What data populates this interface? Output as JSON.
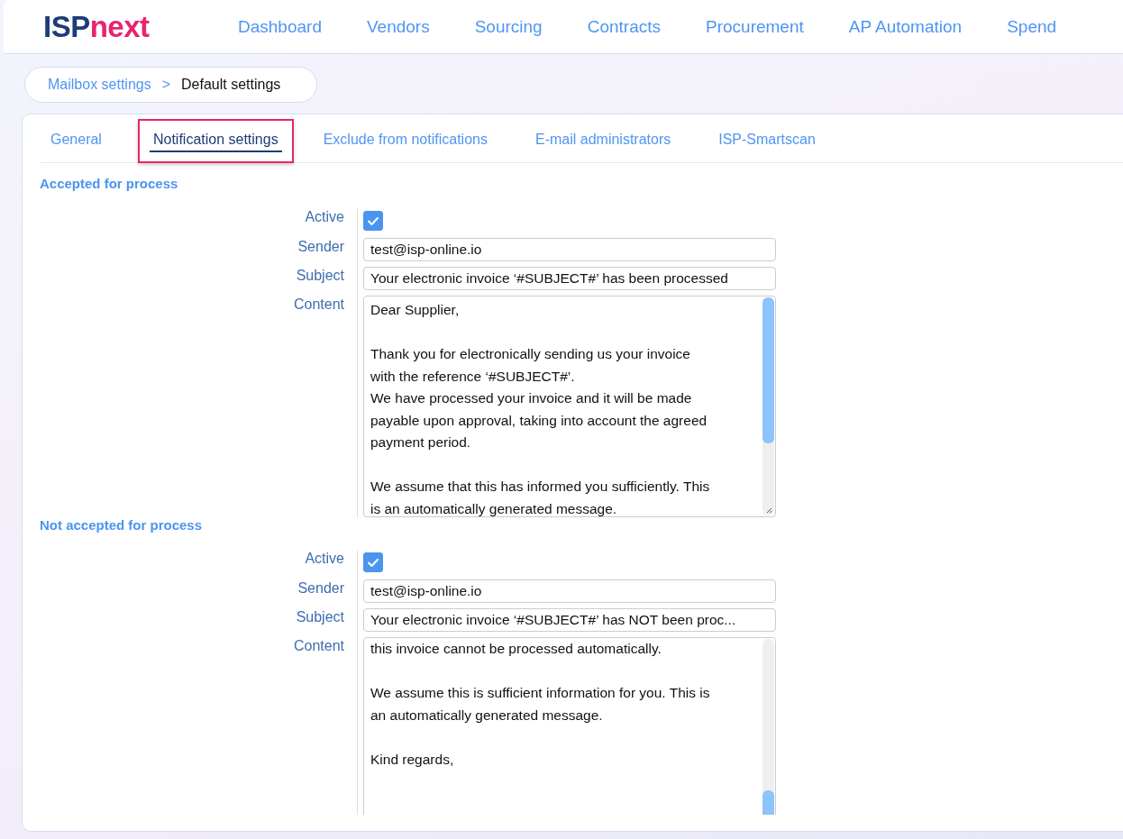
{
  "logo": {
    "part_1": "ISP",
    "part_2": "next"
  },
  "nav": [
    "Dashboard",
    "Vendors",
    "Sourcing",
    "Contracts",
    "Procurement",
    "AP Automation",
    "Spend"
  ],
  "breadcrumb": {
    "parent": "Mailbox settings",
    "separator": ">",
    "current": "Default settings"
  },
  "tabs": [
    {
      "label": "General",
      "selected": false,
      "highlighted": false
    },
    {
      "label": "Notification settings",
      "selected": true,
      "highlighted": true
    },
    {
      "label": "Exclude from notifications",
      "selected": false,
      "highlighted": false
    },
    {
      "label": "E-mail administrators",
      "selected": false,
      "highlighted": false
    },
    {
      "label": "ISP-Smartscan",
      "selected": false,
      "highlighted": false
    }
  ],
  "sections": [
    {
      "title": "Accepted for process",
      "active_label": "Active",
      "active": true,
      "sender_label": "Sender",
      "sender": "test@isp-online.io",
      "subject_label": "Subject",
      "subject": "Your electronic invoice ‘#SUBJECT#’ has been processed",
      "content_label": "Content",
      "scrolled": false,
      "paragraphs": [
        [
          "Dear Supplier,"
        ],
        [
          "Thank you for electronically sending us your invoice",
          "with the reference ‘#SUBJECT#’.",
          "We have processed your invoice and it will be made",
          "payable upon approval, taking into account the agreed",
          "payment period."
        ],
        [
          "We assume that this has informed you sufficiently. This",
          "is an automatically generated message."
        ]
      ]
    },
    {
      "title": "Not accepted for process",
      "active_label": "Active",
      "active": true,
      "sender_label": "Sender",
      "sender": "test@isp-online.io",
      "subject_label": "Subject",
      "subject": "Your electronic invoice ‘#SUBJECT#’ has NOT been proc...",
      "content_label": "Content",
      "scrolled": true,
      "paragraphs": [
        [
          "this invoice cannot be processed automatically."
        ],
        [
          "We assume this is sufficient information for you. This is",
          "an automatically generated message."
        ],
        [
          "Kind regards,"
        ]
      ]
    }
  ]
}
